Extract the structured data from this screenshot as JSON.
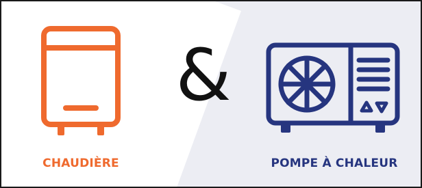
{
  "colors": {
    "boiler": "#ef6a2e",
    "heat_pump": "#26357f",
    "ampersand": "#111111",
    "panel_bg": "#ecedf3",
    "frame_border": "#1a1a1a"
  },
  "icons": {
    "left": "boiler-icon",
    "right": "heat-pump-icon"
  },
  "connector": "&",
  "labels": {
    "left": "CHAUDIÈRE",
    "right": "POMPE À CHALEUR"
  }
}
